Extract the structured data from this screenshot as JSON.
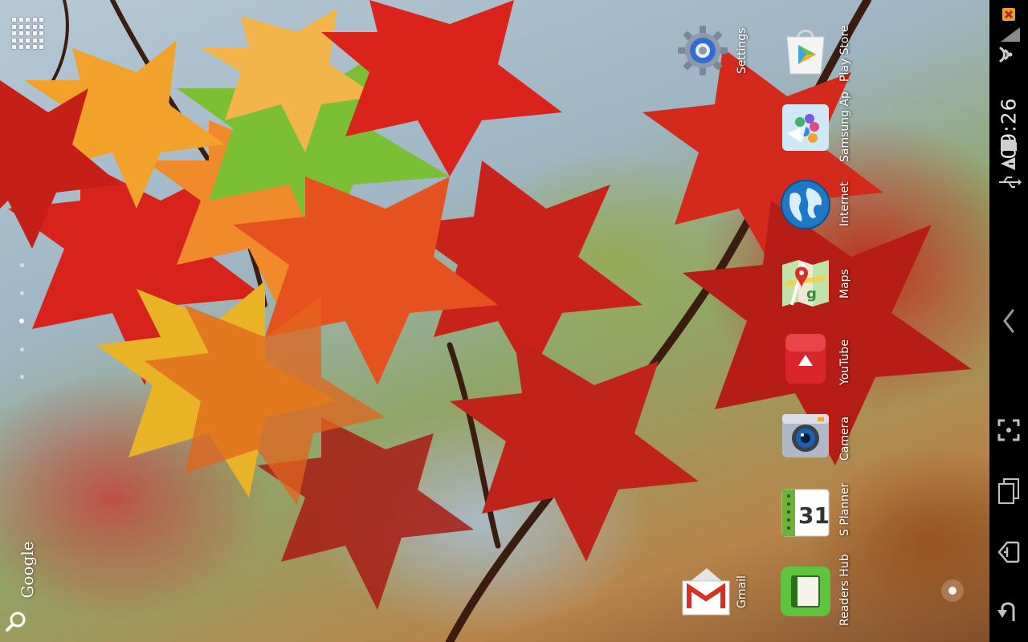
{
  "status_bar": {
    "time": "09:26",
    "icons": [
      "x-alert-icon",
      "signal-icon",
      "wifi-icon",
      "sd-card-icon",
      "warning-icon",
      "usb-icon"
    ]
  },
  "nav_bar": {
    "icons": [
      "back-chevron-icon",
      "screenshot-icon",
      "recent-apps-icon",
      "home-icon",
      "back-icon"
    ]
  },
  "launcher": {
    "apps_button_icon": "apps-grid-icon",
    "page_indicator": {
      "count": 5,
      "active_index": 2
    },
    "google_search": {
      "label": "Google",
      "icon": "search-icon"
    }
  },
  "apps": [
    {
      "id": "settings",
      "label": "Settings",
      "color": "#3a7bd5"
    },
    {
      "id": "play-store",
      "label": "Play Store",
      "color": "#2ea44f"
    },
    {
      "id": "samsung-apps",
      "label": "Samsung Ap",
      "color": "#4aa3e8"
    },
    {
      "id": "internet",
      "label": "Internet",
      "color": "#1e78c8"
    },
    {
      "id": "maps",
      "label": "Maps",
      "color": "#5aa845"
    },
    {
      "id": "youtube",
      "label": "YouTube",
      "color": "#d8262c"
    },
    {
      "id": "camera",
      "label": "Camera",
      "color": "#8a96a8"
    },
    {
      "id": "s-planner",
      "label": "S Planner",
      "color": "#6bb536"
    },
    {
      "id": "readers-hub",
      "label": "Readers Hub",
      "color": "#4cb03a"
    },
    {
      "id": "gmail",
      "label": "Gmail",
      "color": "#d93025"
    }
  ]
}
